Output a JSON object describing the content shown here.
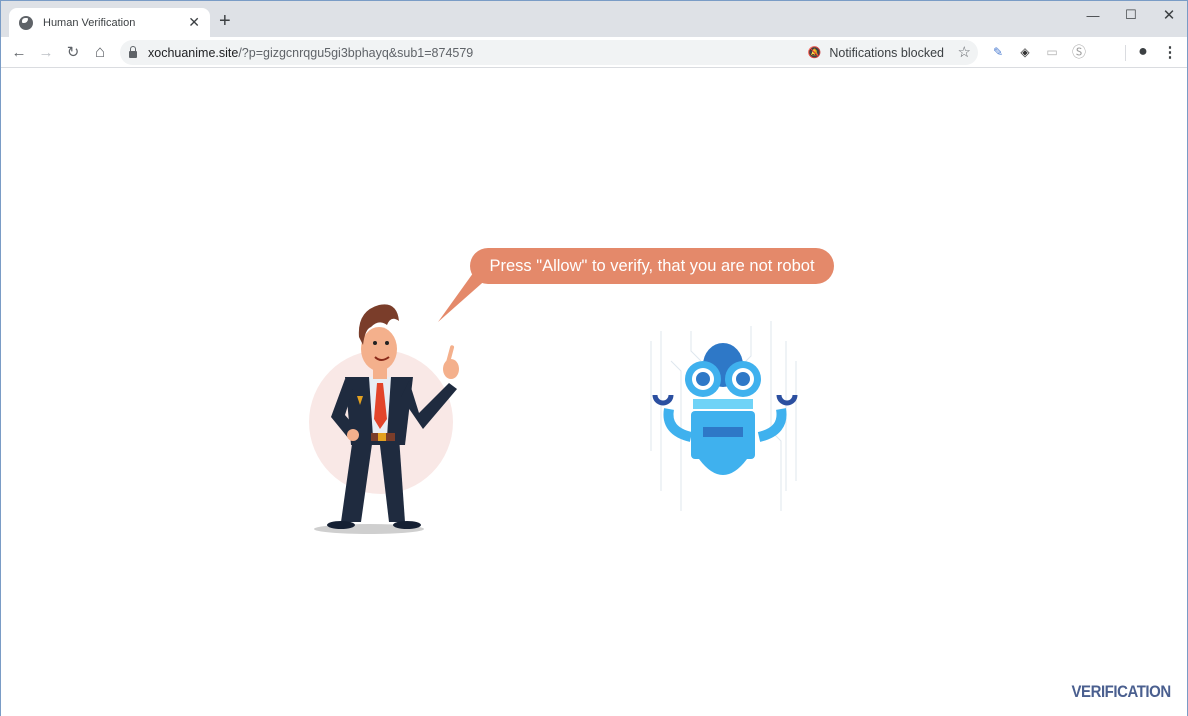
{
  "browser": {
    "tab": {
      "title": "Human Verification",
      "favicon": "globe-icon",
      "close": "✕"
    },
    "new_tab": "+",
    "window_controls": {
      "minimize": "—",
      "maximize": "☐",
      "close": "✕"
    },
    "nav": {
      "back": "←",
      "forward": "→",
      "reload": "↻",
      "home": "⌂"
    },
    "address": {
      "domain": "xochuanime.site",
      "path": "/?p=gizgcnrqgu5gi3bphayq&sub1=874579"
    },
    "notifications": {
      "bell": "🔕",
      "label": "Notifications blocked"
    },
    "bookmark": "☆",
    "extensions": [
      "notes-extension-icon",
      "diamond-extension-icon",
      "tag-extension-icon",
      "s-extension-icon"
    ],
    "ext_glyphs": [
      "✎",
      "◈",
      "▭",
      "Ⓢ"
    ],
    "profile": "●",
    "menu": "⋮"
  },
  "page": {
    "bubble_text": "Press \"Allow\" to verify, that you are not robot",
    "brand": "VERIFICATION",
    "colors": {
      "bubble": "#e4896a",
      "brand": "#4a5f8f",
      "robot": "#3fb1ee",
      "suit": "#1f2b3f"
    }
  }
}
